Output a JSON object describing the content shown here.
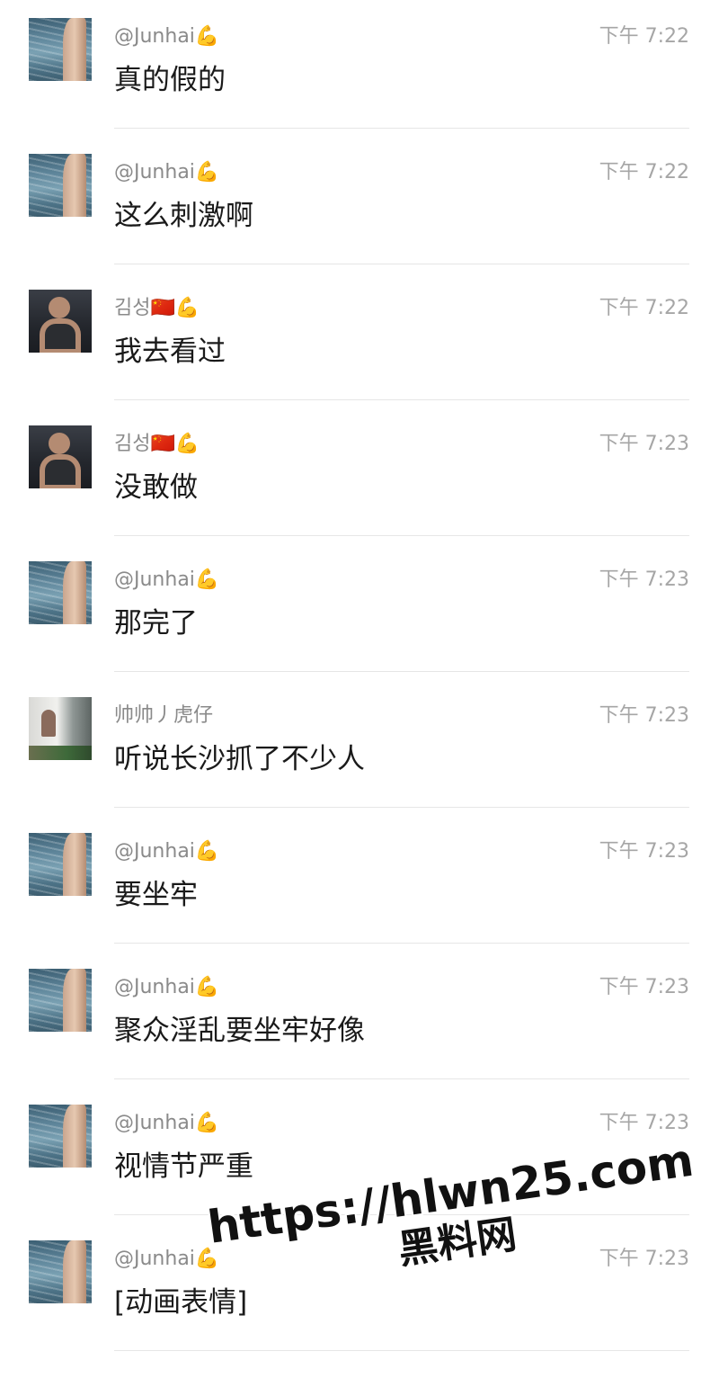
{
  "messages": [
    {
      "sender": "@Junhai💪",
      "time": "下午 7:22",
      "text": "真的假的",
      "avatar": "sea"
    },
    {
      "sender": "@Junhai💪",
      "time": "下午 7:22",
      "text": "这么刺激啊",
      "avatar": "sea"
    },
    {
      "sender": "김성🇨🇳💪",
      "time": "下午 7:22",
      "text": "我去看过",
      "avatar": "dark"
    },
    {
      "sender": "김성🇨🇳💪",
      "time": "下午 7:23",
      "text": "没敢做",
      "avatar": "dark"
    },
    {
      "sender": "@Junhai💪",
      "time": "下午 7:23",
      "text": "那完了",
      "avatar": "sea"
    },
    {
      "sender": "帅帅丿虎仔",
      "time": "下午 7:23",
      "text": "听说长沙抓了不少人",
      "avatar": "room"
    },
    {
      "sender": "@Junhai💪",
      "time": "下午 7:23",
      "text": "要坐牢",
      "avatar": "sea"
    },
    {
      "sender": "@Junhai💪",
      "time": "下午 7:23",
      "text": "聚众淫乱要坐牢好像",
      "avatar": "sea"
    },
    {
      "sender": "@Junhai💪",
      "time": "下午 7:23",
      "text": "视情节严重",
      "avatar": "sea"
    },
    {
      "sender": "@Junhai💪",
      "time": "下午 7:23",
      "text": "[动画表情]",
      "avatar": "sea"
    }
  ],
  "watermark": {
    "url": "https://hlwn25.com",
    "name": "黑料网"
  },
  "colors": {
    "sender": "#8a8a8a",
    "time": "#a6a6a6",
    "message_text": "#1a1a1a",
    "divider": "#e6e6e6"
  }
}
